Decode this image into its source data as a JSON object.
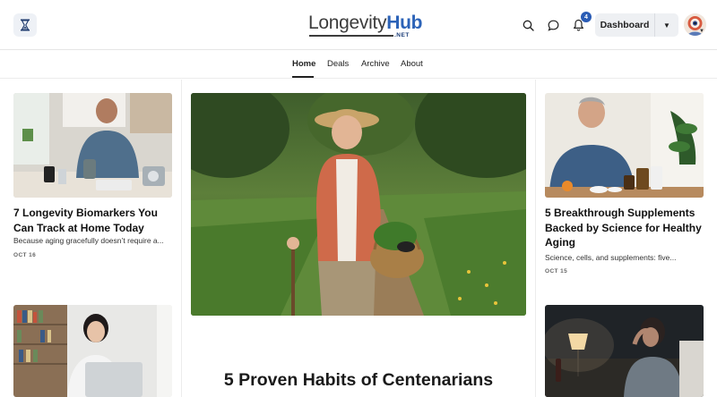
{
  "header": {
    "logo_part1": "Longevity",
    "logo_part2": "Hub",
    "logo_suffix": ".NET",
    "notification_count": "4",
    "dashboard_label": "Dashboard",
    "icons": [
      "hourglass-icon",
      "search-icon",
      "chat-icon",
      "bell-icon",
      "chevron-down-icon"
    ]
  },
  "nav": {
    "items": [
      {
        "label": "Home",
        "active": true
      },
      {
        "label": "Deals"
      },
      {
        "label": "Archive"
      },
      {
        "label": "About"
      }
    ]
  },
  "left_column": {
    "card1": {
      "title": "7 Longevity Biomarkers You Can Track at Home Today",
      "excerpt": "Because aging gracefully doesn’t require a...",
      "date": "OCT 16"
    }
  },
  "feature": {
    "title": "5 Proven Habits of Centenarians"
  },
  "right_column": {
    "card1": {
      "title": "5 Breakthrough Supplements Backed by Science for Healthy Aging",
      "excerpt": "Science, cells, and supplements: five...",
      "date": "OCT 15"
    }
  },
  "colors": {
    "brand_blue": "#2c63b8",
    "badge_blue": "#2a5cb5",
    "text": "#111111"
  }
}
